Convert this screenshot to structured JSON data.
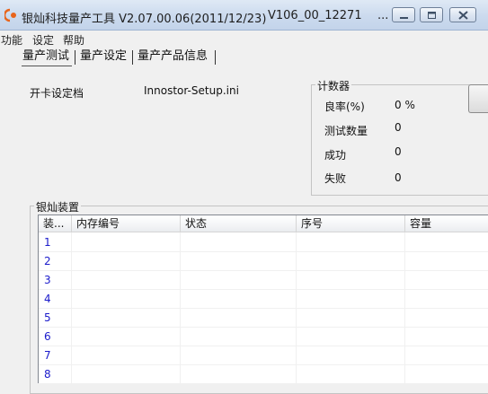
{
  "window": {
    "title": "银灿科技量产工具 V2.07.00.06(2011/12/23)",
    "version_tag": "V106_00_12271",
    "ellipsis": "..."
  },
  "menu": [
    "功能",
    "设定",
    "帮助"
  ],
  "tabs": [
    {
      "label": "量产测试",
      "active": true
    },
    {
      "label": "量产设定",
      "active": false
    },
    {
      "label": "量产产品信息",
      "active": false
    }
  ],
  "card_config": {
    "label": "开卡设定档",
    "value": "Innostor-Setup.ini"
  },
  "counter": {
    "title": "计数器",
    "rows": [
      {
        "label": "良率(%)",
        "value": "0 %"
      },
      {
        "label": "测试数量",
        "value": "0"
      },
      {
        "label": "成功",
        "value": "0"
      },
      {
        "label": "失败",
        "value": "0"
      }
    ]
  },
  "devices": {
    "title": "银灿装置",
    "columns": [
      "装...",
      "内存编号",
      "状态",
      "序号",
      "容量"
    ],
    "rows": [
      "1",
      "2",
      "3",
      "4",
      "5",
      "6",
      "7",
      "8"
    ]
  },
  "colors": {
    "row_number": "#1a1acb",
    "titlebar": "#cbdaee",
    "app_icon": "#e8641b"
  }
}
